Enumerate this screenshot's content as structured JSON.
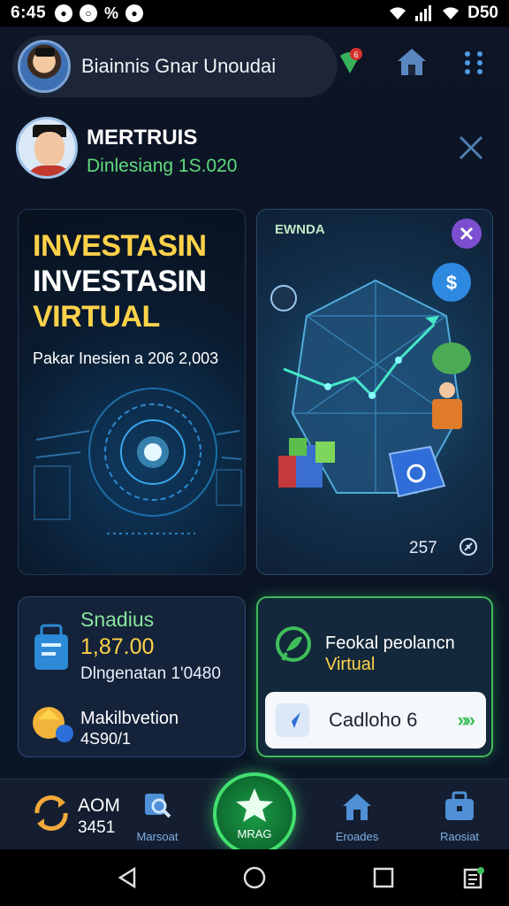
{
  "status_bar": {
    "time": "6:45",
    "indicators": "0 0 %",
    "battery": "D50"
  },
  "header": {
    "app_title": "Biainnis Gnar Unoudai",
    "icons": [
      "notification-badge-icon",
      "home-icon",
      "grid-menu-icon"
    ]
  },
  "user": {
    "name": "MERTRUIS",
    "subtitle": "Dinlesiang 1S.020"
  },
  "hero_left": {
    "line1": "INVESTASIN",
    "line2": "INVESTASIN",
    "line3": "VIRTUAL",
    "subtitle": "Pakar Inesien a 206 2,003"
  },
  "hero_right": {
    "tag": "EWNDA",
    "count": "257"
  },
  "stats": {
    "title": "Snadius",
    "value": "1,87.00",
    "subtitle": "Dlngenatan 1'0480",
    "item_label": "Makilbvetion",
    "item_value": "4S90/1"
  },
  "promo": {
    "line1": "Feokal peolancn",
    "line2": "Virtual",
    "button_label": "Cadloho 6",
    "button_arrow": "»»"
  },
  "bottom_nav": {
    "aom_label": "AOM",
    "aom_value": "3451",
    "items": [
      {
        "label": "Marsoat",
        "icon": "search-icon"
      },
      {
        "label": "MRAG",
        "icon": "star-icon"
      },
      {
        "label": "Eroades",
        "icon": "house-icon"
      },
      {
        "label": "Raosiat",
        "icon": "briefcase-icon"
      }
    ]
  },
  "colors": {
    "accent_green": "#42e070",
    "accent_yellow": "#ffd24a",
    "background": "#0b1220"
  }
}
